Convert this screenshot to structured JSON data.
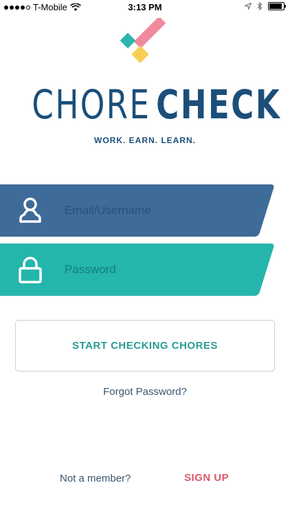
{
  "status_bar": {
    "carrier": "T-Mobile",
    "time": "3:13 PM",
    "battery_level": 0.9,
    "icons": [
      "signal-dots-icon",
      "wifi-icon",
      "location-arrow-icon",
      "bluetooth-icon",
      "battery-icon"
    ]
  },
  "brand": {
    "name_part1": "CHORE",
    "name_part2": "CHECK",
    "tagline": "WORK. EARN. LEARN.",
    "colors": {
      "navy": "#1b4f7a",
      "teal": "#2bb5ad",
      "pink": "#ef8a9c",
      "yellow": "#f7cf55"
    }
  },
  "login": {
    "email_placeholder": "Email/Username",
    "email_value": "",
    "email_icon": "user-icon",
    "email_bg": "#3f6b98",
    "password_placeholder": "Password",
    "password_value": "",
    "password_icon": "lock-icon",
    "password_bg": "#24b6ad",
    "submit_label": "START CHECKING CHORES",
    "forgot_label": "Forgot Password?"
  },
  "footer": {
    "prompt": "Not a member?",
    "signup_label": "SIGN UP"
  }
}
